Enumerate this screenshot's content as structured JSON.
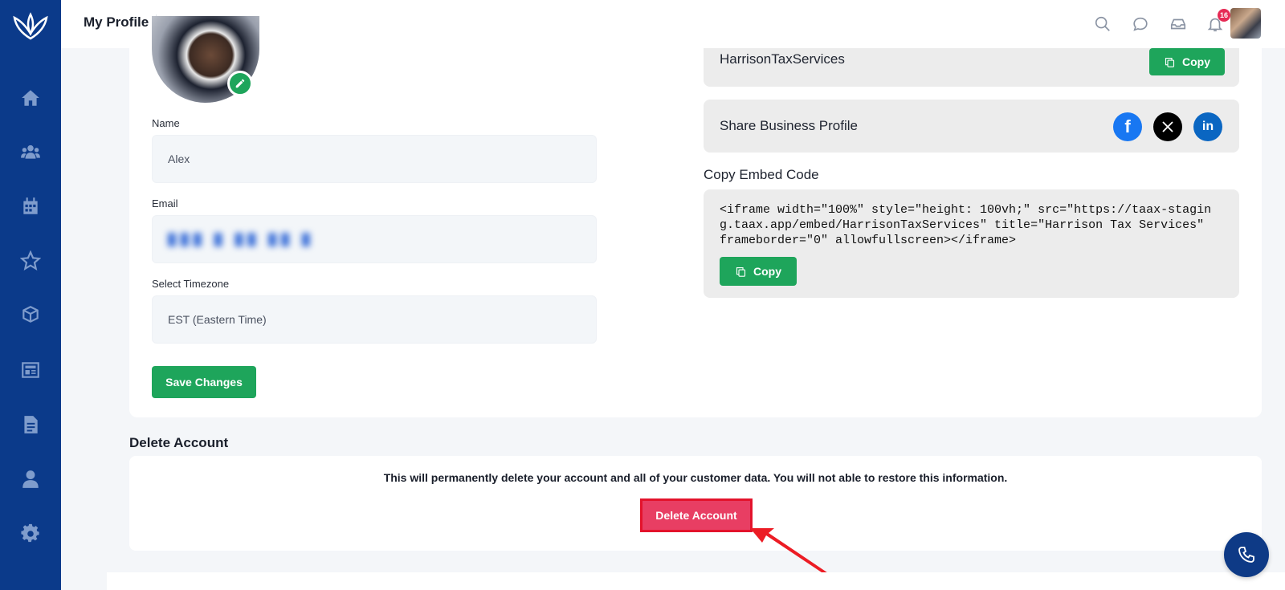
{
  "header": {
    "title": "My Profile",
    "notification_count": "16",
    "icons": [
      "search-icon",
      "chat-icon",
      "inbox-icon",
      "bell-icon"
    ]
  },
  "sidebar": {
    "items": [
      "home-icon",
      "users-icon",
      "calendar-icon",
      "star-icon",
      "package-icon",
      "newspaper-icon",
      "document-icon",
      "person-icon",
      "gear-icon"
    ]
  },
  "profile": {
    "name_label": "Name",
    "name_value": "Alex",
    "email_label": "Email",
    "email_value": "███ █ ██ ██ █",
    "timezone_label": "Select Timezone",
    "timezone_value": "EST (Eastern Time)",
    "save_label": "Save Changes"
  },
  "business": {
    "slug": "HarrisonTaxServices",
    "copy_label": "Copy",
    "share_label": "Share Business Profile",
    "social": [
      "facebook-icon",
      "x-icon",
      "linkedin-icon"
    ],
    "embed_label": "Copy Embed Code",
    "embed_code": "<iframe width=\"100%\" style=\"height: 100vh;\" src=\"https://taax-staging.taax.app/embed/HarrisonTaxServices\" title=\"Harrison Tax Services\" frameborder=\"0\" allowfullscreen></iframe>",
    "embed_copy_label": "Copy"
  },
  "delete": {
    "heading": "Delete Account",
    "warning": "This will permanently delete your account and all of your customer data. You will not able to restore this information.",
    "button_label": "Delete Account"
  },
  "colors": {
    "sidebar": "#0b3a8a",
    "accent_green": "#1ea55b",
    "danger": "#e83e63",
    "annotation_red": "#e3132c"
  }
}
